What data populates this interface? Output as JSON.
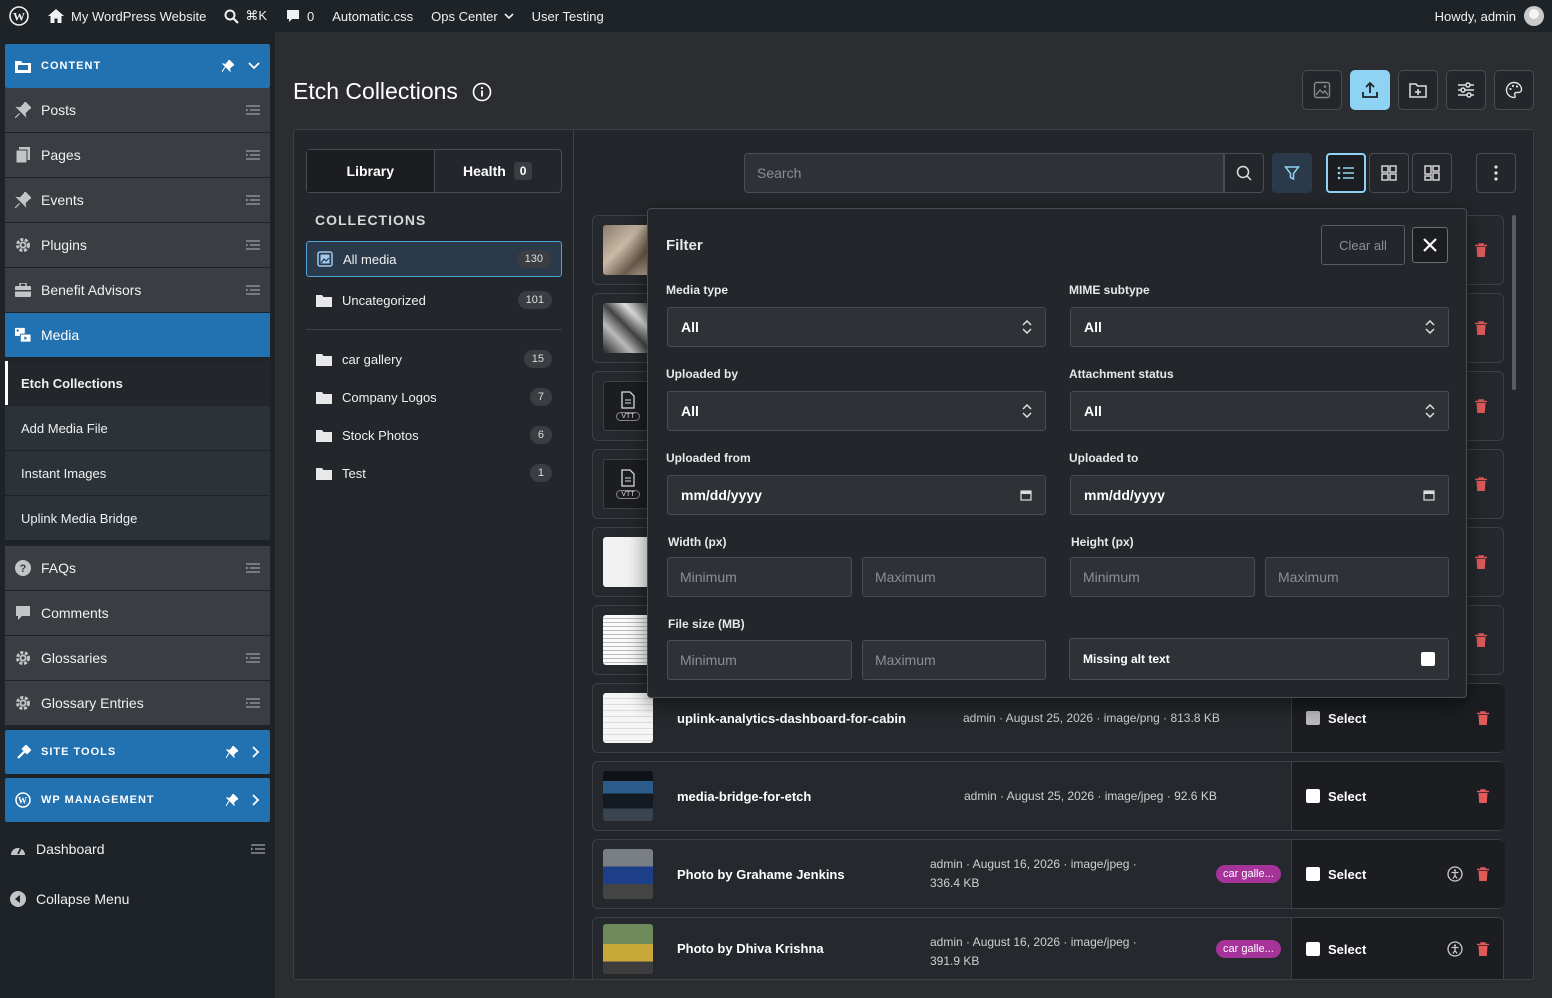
{
  "admin_bar": {
    "site_name": "My WordPress Website",
    "search_shortcut": "⌘K",
    "comments_count": "0",
    "items": [
      "Automatic.css",
      "Ops Center",
      "User Testing"
    ],
    "greeting": "Howdy, admin"
  },
  "sidebar": {
    "sections": {
      "content": "CONTENT",
      "site_tools": "SITE TOOLS",
      "wp_management": "WP MANAGEMENT"
    },
    "items": [
      "Posts",
      "Pages",
      "Events",
      "Plugins",
      "Benefit Advisors",
      "Media"
    ],
    "media_submenu": [
      "Etch Collections",
      "Add Media File",
      "Instant Images",
      "Uplink Media Bridge"
    ],
    "items2": [
      "FAQs",
      "Comments",
      "Glossaries",
      "Glossary Entries"
    ],
    "bottom": [
      "Dashboard",
      "Collapse Menu"
    ]
  },
  "page": {
    "title": "Etch Collections"
  },
  "tabs": {
    "library": "Library",
    "health": "Health",
    "health_count": "0"
  },
  "collections": {
    "heading": "COLLECTIONS",
    "all": {
      "label": "All media",
      "count": "130"
    },
    "uncategorized": {
      "label": "Uncategorized",
      "count": "101"
    },
    "list": [
      {
        "label": "car gallery",
        "count": "15"
      },
      {
        "label": "Company Logos",
        "count": "7"
      },
      {
        "label": "Stock Photos",
        "count": "6"
      },
      {
        "label": "Test",
        "count": "1"
      }
    ]
  },
  "search": {
    "placeholder": "Search"
  },
  "media_rows": [
    {
      "name": "uplink-analytics-dashboard-for-cabin",
      "meta": "admin · August 25, 2026 · image/png · 813.8 KB",
      "select": "Select"
    },
    {
      "name": "media-bridge-for-etch",
      "meta": "admin · August 25, 2026 · image/jpeg · 92.6 KB",
      "select": "Select"
    },
    {
      "name": "Photo by Grahame Jenkins",
      "meta": "admin · August 16, 2026 · image/jpeg ·",
      "meta2": "336.4 KB",
      "tag": "car galle...",
      "select": "Select"
    },
    {
      "name": "Photo by Dhiva Krishna",
      "meta": "admin · August 16, 2026 · image/jpeg ·",
      "meta2": "391.9 KB",
      "tag": "car galle...",
      "select": "Select"
    }
  ],
  "thumb_labels": {
    "vtt": "VTT"
  },
  "filter": {
    "title": "Filter",
    "clear_all": "Clear all",
    "media_type": {
      "label": "Media type",
      "value": "All"
    },
    "mime_subtype": {
      "label": "MIME subtype",
      "value": "All"
    },
    "uploaded_by": {
      "label": "Uploaded by",
      "value": "All"
    },
    "attachment_status": {
      "label": "Attachment status",
      "value": "All"
    },
    "uploaded_from": {
      "label": "Uploaded from",
      "value": "mm/dd/yyyy"
    },
    "uploaded_to": {
      "label": "Uploaded to",
      "value": "mm/dd/yyyy"
    },
    "width": {
      "label": "Width (px)",
      "min": "Minimum",
      "max": "Maximum"
    },
    "height": {
      "label": "Height (px)",
      "min": "Minimum",
      "max": "Maximum"
    },
    "file_size": {
      "label": "File size (MB)",
      "min": "Minimum",
      "max": "Maximum"
    },
    "missing_alt": "Missing alt text"
  },
  "colors": {
    "wp_blue": "#2271b1",
    "accent": "#8fd3f4",
    "danger": "#e05a5a",
    "tag": "#a6339a"
  }
}
